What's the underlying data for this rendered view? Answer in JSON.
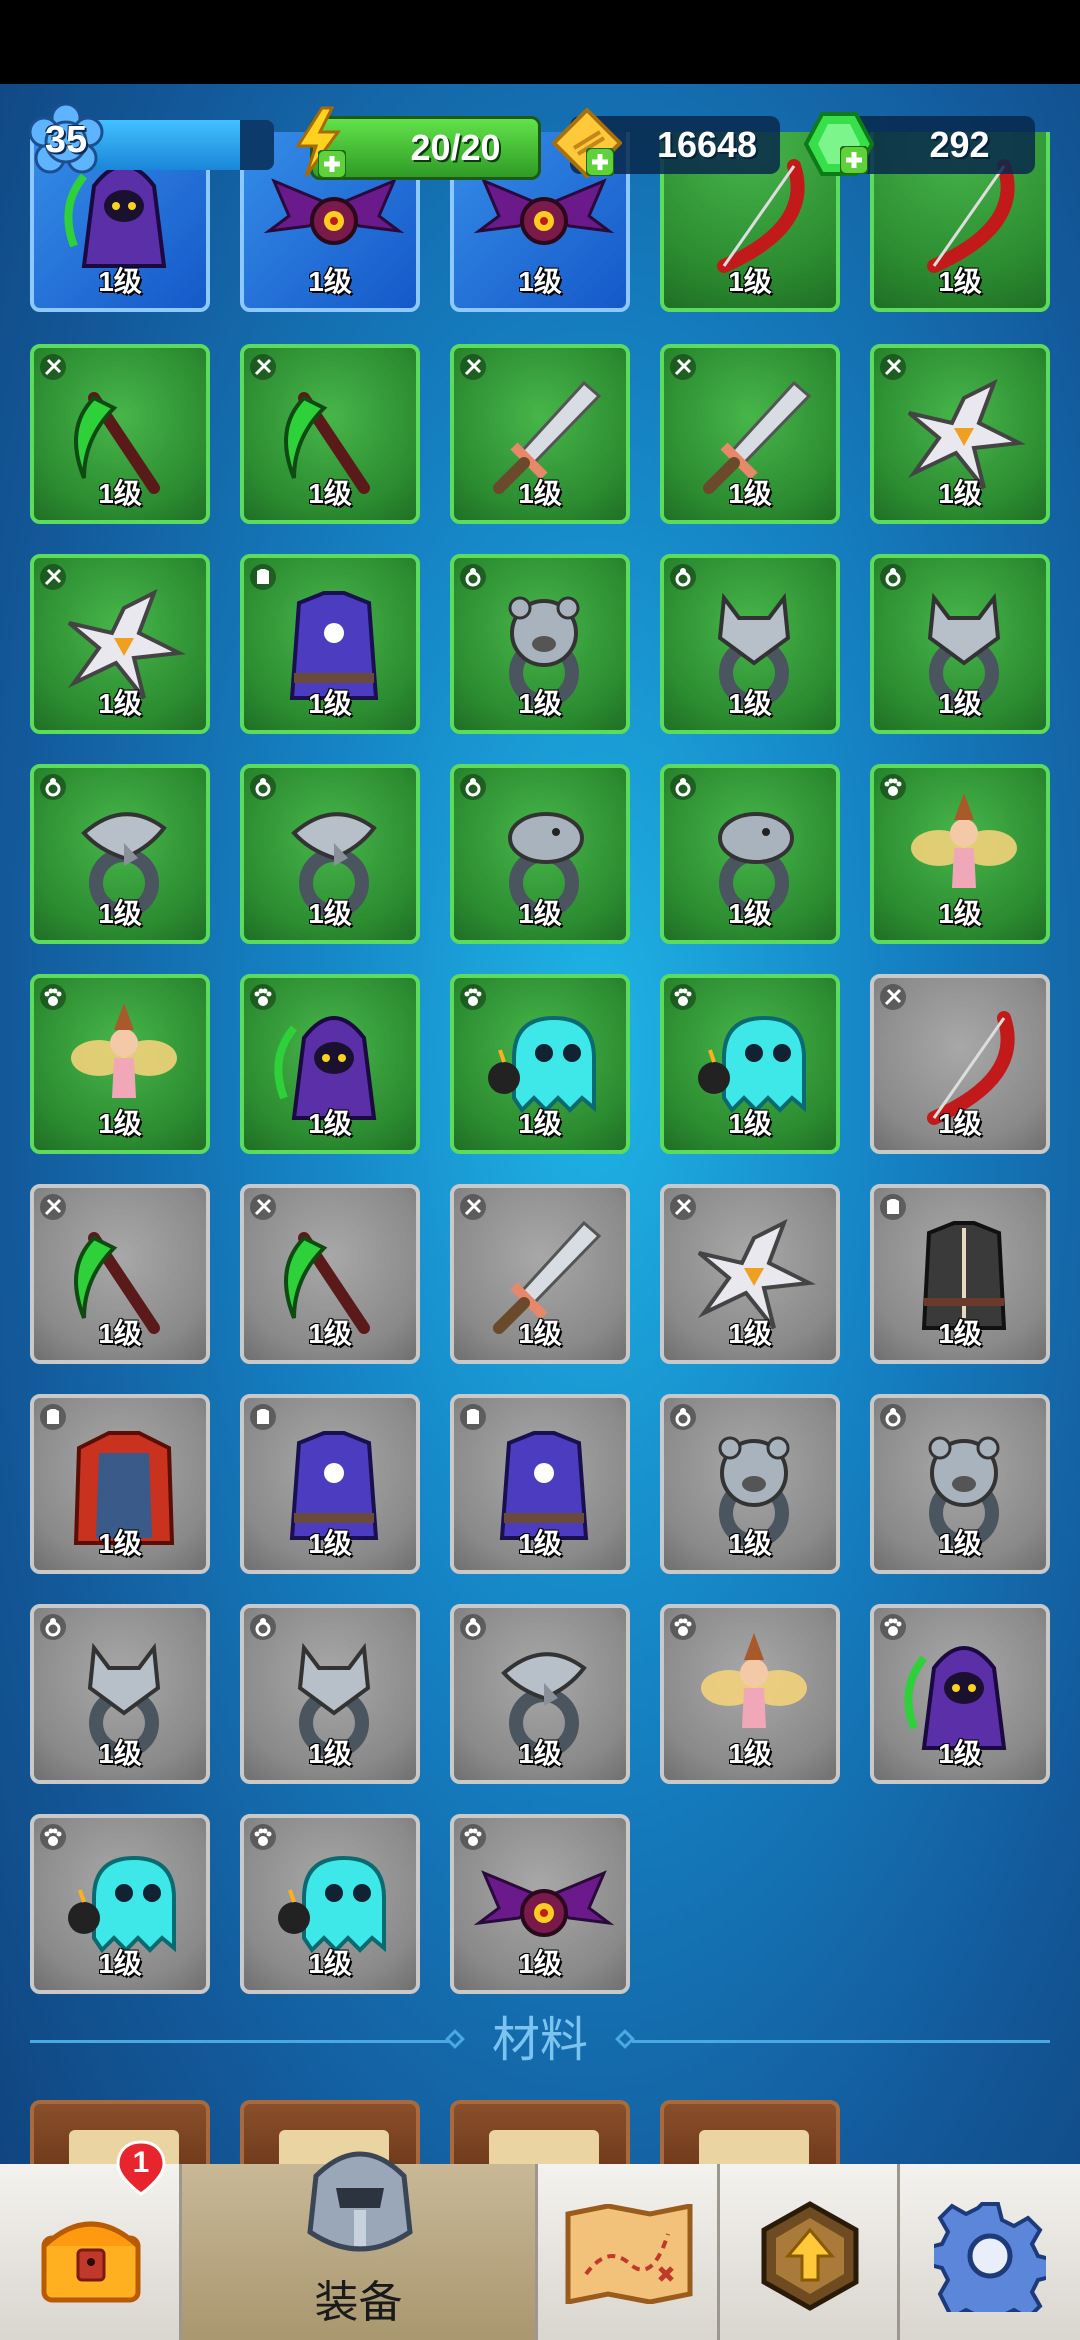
{
  "hud": {
    "level": "35",
    "xp_progress": 0.82,
    "energy": "20/20",
    "gold": "16648",
    "gems": "292"
  },
  "level_text": "1级",
  "items": [
    {
      "rarity": "blue",
      "slot": "pet-icon",
      "art": "reaper-pet"
    },
    {
      "rarity": "blue",
      "slot": "pet-icon",
      "art": "bat-pet"
    },
    {
      "rarity": "blue",
      "slot": "pet-icon",
      "art": "bat-pet"
    },
    {
      "rarity": "green",
      "slot": "weapon-icon",
      "art": "bow"
    },
    {
      "rarity": "green",
      "slot": "weapon-icon",
      "art": "bow"
    },
    {
      "rarity": "green",
      "slot": "weapon-icon",
      "art": "scythe"
    },
    {
      "rarity": "green",
      "slot": "weapon-icon",
      "art": "scythe"
    },
    {
      "rarity": "green",
      "slot": "weapon-icon",
      "art": "sword"
    },
    {
      "rarity": "green",
      "slot": "weapon-icon",
      "art": "sword"
    },
    {
      "rarity": "green",
      "slot": "weapon-icon",
      "art": "shuriken"
    },
    {
      "rarity": "green",
      "slot": "weapon-icon",
      "art": "shuriken"
    },
    {
      "rarity": "green",
      "slot": "armor-icon",
      "art": "purple-robe"
    },
    {
      "rarity": "green",
      "slot": "ring-icon",
      "art": "bear-ring"
    },
    {
      "rarity": "green",
      "slot": "ring-icon",
      "art": "wolf-ring"
    },
    {
      "rarity": "green",
      "slot": "ring-icon",
      "art": "wolf-ring"
    },
    {
      "rarity": "green",
      "slot": "ring-icon",
      "art": "eagle-ring"
    },
    {
      "rarity": "green",
      "slot": "ring-icon",
      "art": "eagle-ring"
    },
    {
      "rarity": "green",
      "slot": "ring-icon",
      "art": "serpent-ring"
    },
    {
      "rarity": "green",
      "slot": "ring-icon",
      "art": "serpent-ring"
    },
    {
      "rarity": "green",
      "slot": "pet-icon",
      "art": "fairy-pet"
    },
    {
      "rarity": "green",
      "slot": "pet-icon",
      "art": "fairy-pet"
    },
    {
      "rarity": "green",
      "slot": "pet-icon",
      "art": "reaper-pet"
    },
    {
      "rarity": "green",
      "slot": "pet-icon",
      "art": "ghost-pet"
    },
    {
      "rarity": "green",
      "slot": "pet-icon",
      "art": "ghost-pet"
    },
    {
      "rarity": "gray",
      "slot": "weapon-icon",
      "art": "bow"
    },
    {
      "rarity": "gray",
      "slot": "weapon-icon",
      "art": "scythe"
    },
    {
      "rarity": "gray",
      "slot": "weapon-icon",
      "art": "scythe"
    },
    {
      "rarity": "gray",
      "slot": "weapon-icon",
      "art": "sword"
    },
    {
      "rarity": "gray",
      "slot": "weapon-icon",
      "art": "shuriken"
    },
    {
      "rarity": "gray",
      "slot": "armor-icon",
      "art": "dark-vest"
    },
    {
      "rarity": "gray",
      "slot": "armor-icon",
      "art": "red-cloak"
    },
    {
      "rarity": "gray",
      "slot": "armor-icon",
      "art": "purple-robe"
    },
    {
      "rarity": "gray",
      "slot": "armor-icon",
      "art": "purple-robe"
    },
    {
      "rarity": "gray",
      "slot": "ring-icon",
      "art": "bear-ring"
    },
    {
      "rarity": "gray",
      "slot": "ring-icon",
      "art": "bear-ring"
    },
    {
      "rarity": "gray",
      "slot": "ring-icon",
      "art": "wolf-ring"
    },
    {
      "rarity": "gray",
      "slot": "ring-icon",
      "art": "wolf-ring"
    },
    {
      "rarity": "gray",
      "slot": "ring-icon",
      "art": "eagle-ring"
    },
    {
      "rarity": "gray",
      "slot": "pet-icon",
      "art": "fairy-pet"
    },
    {
      "rarity": "gray",
      "slot": "pet-icon",
      "art": "reaper-pet"
    },
    {
      "rarity": "gray",
      "slot": "pet-icon",
      "art": "ghost-pet"
    },
    {
      "rarity": "gray",
      "slot": "pet-icon",
      "art": "ghost-pet"
    },
    {
      "rarity": "gray",
      "slot": "pet-icon",
      "art": "bat-pet"
    }
  ],
  "section": {
    "materials_title": "材料"
  },
  "nav": {
    "chest_badge": "1",
    "equipment_label": "装备"
  },
  "colors": {
    "rarity_blue": "#1f6fd6",
    "rarity_green": "#2f9a33",
    "rarity_gray": "#8f8f8f",
    "accent": "#4aa9e0"
  }
}
